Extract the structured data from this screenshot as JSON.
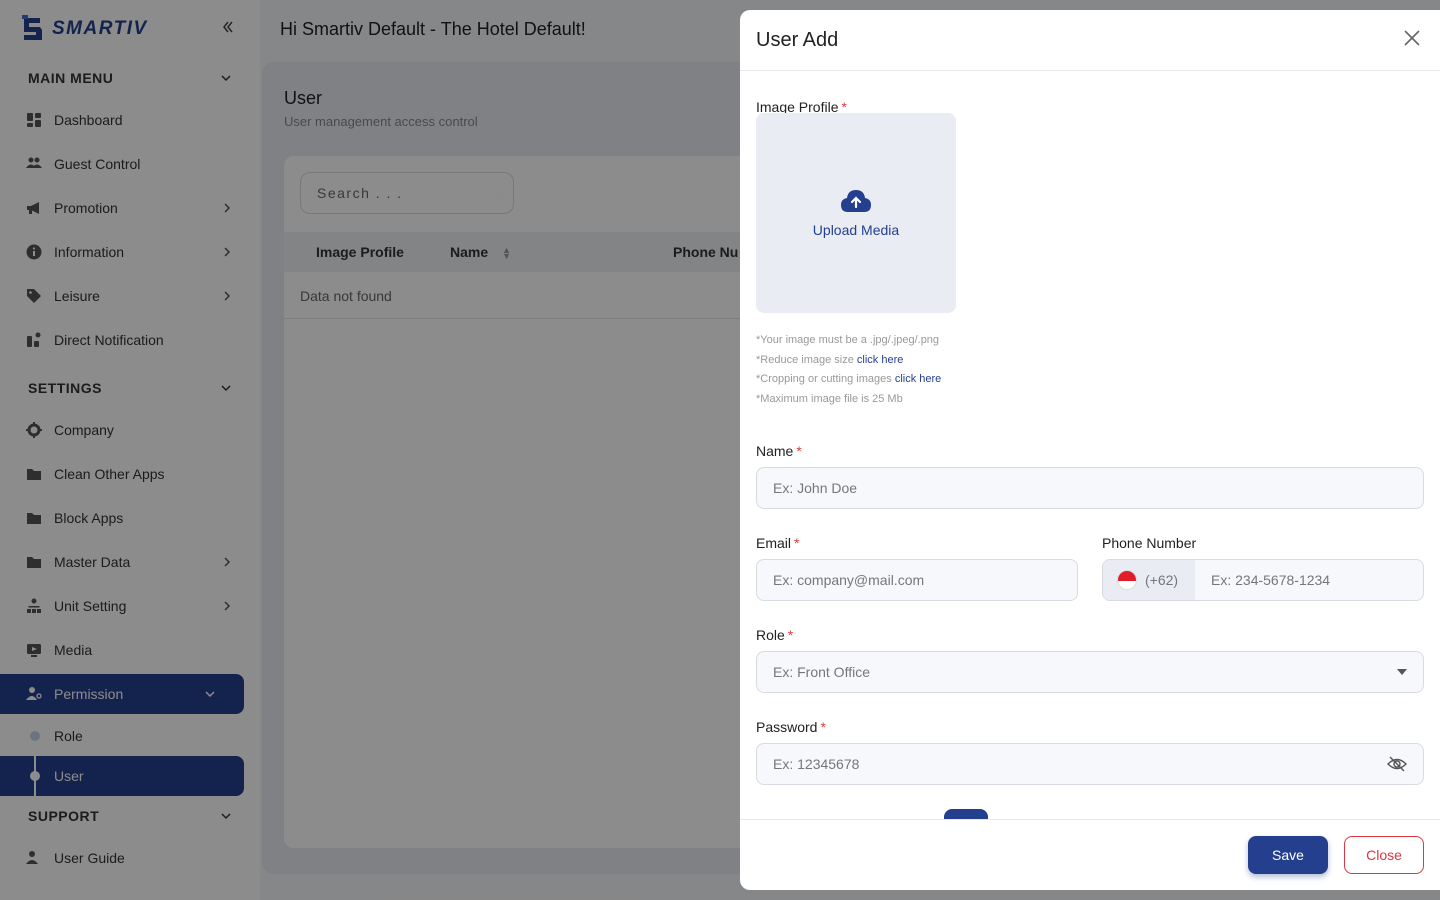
{
  "brand": {
    "name": "SMARTIV",
    "color": "#253f8f"
  },
  "header": {
    "greeting": "Hi Smartiv Default - The Hotel Default!"
  },
  "sidebar": {
    "main_menu": {
      "title": "MAIN MENU",
      "items": [
        {
          "label": "Dashboard",
          "icon": "dashboard-icon"
        },
        {
          "label": "Guest Control",
          "icon": "users-icon"
        },
        {
          "label": "Promotion",
          "icon": "megaphone-icon"
        },
        {
          "label": "Information",
          "icon": "info-icon"
        },
        {
          "label": "Leisure",
          "icon": "tag-icon"
        },
        {
          "label": "Direct Notification",
          "icon": "notification-icon"
        }
      ]
    },
    "settings": {
      "title": "SETTINGS",
      "items": [
        {
          "label": "Company",
          "icon": "gear-icon"
        },
        {
          "label": "Clean Other Apps",
          "icon": "folder-icon"
        },
        {
          "label": "Block Apps",
          "icon": "folder-icon"
        },
        {
          "label": "Master Data",
          "icon": "folder-icon"
        },
        {
          "label": "Unit Setting",
          "icon": "sitemap-icon"
        },
        {
          "label": "Media",
          "icon": "media-icon"
        },
        {
          "label": "Permission",
          "icon": "user-key-icon"
        }
      ],
      "permission_sub": [
        {
          "label": "Role"
        },
        {
          "label": "User"
        }
      ]
    },
    "support": {
      "title": "SUPPORT",
      "items": [
        {
          "label": "User Guide",
          "icon": "guide-icon"
        }
      ]
    }
  },
  "page": {
    "title": "User",
    "subtitle": "User management access control",
    "search_placeholder": "Search . . .",
    "columns": [
      "Image Profile",
      "Name",
      "Phone Nu"
    ],
    "empty_text": "Data not found"
  },
  "modal": {
    "title": "User Add",
    "image_profile": {
      "label": "Image Profile",
      "upload_label": "Upload Media",
      "hint_1": "*Your image must be a .jpg/.jpeg/.png",
      "hint_2": "*Reduce image size",
      "hint_3": "*Cropping or cutting images",
      "hint_4": "*Maximum image file is 25 Mb",
      "link_text": "click here"
    },
    "name": {
      "label": "Name",
      "placeholder": "Ex: John Doe"
    },
    "email": {
      "label": "Email",
      "placeholder": "Ex: company@mail.com"
    },
    "phone": {
      "label": "Phone Number",
      "country_code": "(+62)",
      "placeholder": "Ex: 234-5678-1234"
    },
    "role": {
      "label": "Role",
      "placeholder": "Ex: Front Office"
    },
    "password": {
      "label": "Password",
      "placeholder": "Ex: 12345678"
    },
    "save_label": "Save",
    "close_label": "Close"
  }
}
